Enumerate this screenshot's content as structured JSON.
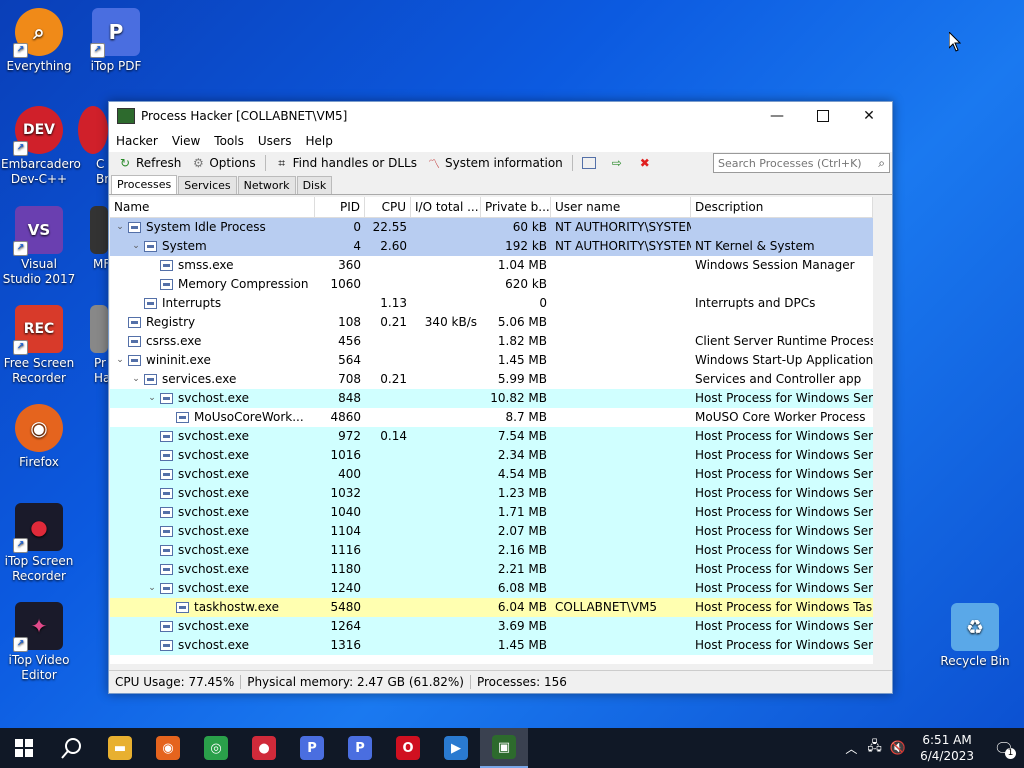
{
  "desktop": {
    "icons": [
      {
        "label": "Everything",
        "color": "#f08a18",
        "glyph": "⌕"
      },
      {
        "label": "iTop PDF",
        "color": "#4a6ee0",
        "glyph": "P"
      },
      {
        "label": "Embarcadero Dev-C++",
        "color": "#d0202a",
        "glyph": "DEV"
      },
      {
        "label": "Visual Studio 2017",
        "color": "#6a3fb0",
        "glyph": "VS"
      },
      {
        "label": "Free Screen Recorder",
        "color": "#d83a2a",
        "glyph": "REC"
      },
      {
        "label": "Firefox",
        "color": "#e5641e",
        "glyph": "◉"
      },
      {
        "label": "iTop Screen Recorder",
        "color": "#1a1a2a",
        "glyph": "●"
      },
      {
        "label": "iTop Video Editor",
        "color": "#1a1a2a",
        "glyph": "✦"
      },
      {
        "label": "Recycle Bin",
        "color": "#5aa8e8",
        "glyph": "♻"
      }
    ],
    "partial_labels": [
      "C",
      "Br",
      "MF",
      "Pr",
      "Ha"
    ]
  },
  "window": {
    "title": "Process Hacker [COLLABNET\\VM5]",
    "menu": [
      "Hacker",
      "View",
      "Tools",
      "Users",
      "Help"
    ],
    "toolbar": {
      "refresh": "Refresh",
      "options": "Options",
      "find_handles": "Find handles or DLLs",
      "system_info": "System information"
    },
    "search_placeholder": "Search Processes (Ctrl+K)",
    "tabs": [
      "Processes",
      "Services",
      "Network",
      "Disk"
    ],
    "columns": [
      "Name",
      "PID",
      "CPU",
      "I/O total ...",
      "Private b...",
      "User name",
      "Description"
    ],
    "rows": [
      {
        "name": "System Idle Process",
        "depth": 0,
        "exp": "v",
        "pid": "0",
        "cpu": "22.55",
        "io": "",
        "priv": "60 kB",
        "user": "NT AUTHORITY\\SYSTEM",
        "desc": "",
        "kind": "system"
      },
      {
        "name": "System",
        "depth": 1,
        "exp": "v",
        "pid": "4",
        "cpu": "2.60",
        "io": "",
        "priv": "192 kB",
        "user": "NT AUTHORITY\\SYSTEM",
        "desc": "NT Kernel & System",
        "kind": "system"
      },
      {
        "name": "smss.exe",
        "depth": 2,
        "exp": "",
        "pid": "360",
        "cpu": "",
        "io": "",
        "priv": "1.04 MB",
        "user": "",
        "desc": "Windows Session Manager",
        "kind": ""
      },
      {
        "name": "Memory Compression",
        "depth": 2,
        "exp": "",
        "pid": "1060",
        "cpu": "",
        "io": "",
        "priv": "620 kB",
        "user": "",
        "desc": "",
        "kind": ""
      },
      {
        "name": "Interrupts",
        "depth": 1,
        "exp": "",
        "pid": "",
        "cpu": "1.13",
        "io": "",
        "priv": "0",
        "user": "",
        "desc": "Interrupts and DPCs",
        "kind": ""
      },
      {
        "name": "Registry",
        "depth": 0,
        "exp": "",
        "pid": "108",
        "cpu": "0.21",
        "io": "340 kB/s",
        "priv": "5.06 MB",
        "user": "",
        "desc": "",
        "kind": ""
      },
      {
        "name": "csrss.exe",
        "depth": 0,
        "exp": "",
        "pid": "456",
        "cpu": "",
        "io": "",
        "priv": "1.82 MB",
        "user": "",
        "desc": "Client Server Runtime Process",
        "kind": ""
      },
      {
        "name": "wininit.exe",
        "depth": 0,
        "exp": "v",
        "pid": "564",
        "cpu": "",
        "io": "",
        "priv": "1.45 MB",
        "user": "",
        "desc": "Windows Start-Up Application",
        "kind": ""
      },
      {
        "name": "services.exe",
        "depth": 1,
        "exp": "v",
        "pid": "708",
        "cpu": "0.21",
        "io": "",
        "priv": "5.99 MB",
        "user": "",
        "desc": "Services and Controller app",
        "kind": ""
      },
      {
        "name": "svchost.exe",
        "depth": 2,
        "exp": "v",
        "pid": "848",
        "cpu": "",
        "io": "",
        "priv": "10.82 MB",
        "user": "",
        "desc": "Host Process for Windows Ser...",
        "kind": "service"
      },
      {
        "name": "MoUsoCoreWork...",
        "depth": 3,
        "exp": "",
        "pid": "4860",
        "cpu": "",
        "io": "",
        "priv": "8.7 MB",
        "user": "",
        "desc": "MoUSO Core Worker Process",
        "kind": ""
      },
      {
        "name": "svchost.exe",
        "depth": 2,
        "exp": "",
        "pid": "972",
        "cpu": "0.14",
        "io": "",
        "priv": "7.54 MB",
        "user": "",
        "desc": "Host Process for Windows Ser...",
        "kind": "service"
      },
      {
        "name": "svchost.exe",
        "depth": 2,
        "exp": "",
        "pid": "1016",
        "cpu": "",
        "io": "",
        "priv": "2.34 MB",
        "user": "",
        "desc": "Host Process for Windows Ser...",
        "kind": "service"
      },
      {
        "name": "svchost.exe",
        "depth": 2,
        "exp": "",
        "pid": "400",
        "cpu": "",
        "io": "",
        "priv": "4.54 MB",
        "user": "",
        "desc": "Host Process for Windows Ser...",
        "kind": "service"
      },
      {
        "name": "svchost.exe",
        "depth": 2,
        "exp": "",
        "pid": "1032",
        "cpu": "",
        "io": "",
        "priv": "1.23 MB",
        "user": "",
        "desc": "Host Process for Windows Ser...",
        "kind": "service"
      },
      {
        "name": "svchost.exe",
        "depth": 2,
        "exp": "",
        "pid": "1040",
        "cpu": "",
        "io": "",
        "priv": "1.71 MB",
        "user": "",
        "desc": "Host Process for Windows Ser...",
        "kind": "service"
      },
      {
        "name": "svchost.exe",
        "depth": 2,
        "exp": "",
        "pid": "1104",
        "cpu": "",
        "io": "",
        "priv": "2.07 MB",
        "user": "",
        "desc": "Host Process for Windows Ser...",
        "kind": "service"
      },
      {
        "name": "svchost.exe",
        "depth": 2,
        "exp": "",
        "pid": "1116",
        "cpu": "",
        "io": "",
        "priv": "2.16 MB",
        "user": "",
        "desc": "Host Process for Windows Ser...",
        "kind": "service"
      },
      {
        "name": "svchost.exe",
        "depth": 2,
        "exp": "",
        "pid": "1180",
        "cpu": "",
        "io": "",
        "priv": "2.21 MB",
        "user": "",
        "desc": "Host Process for Windows Ser...",
        "kind": "service"
      },
      {
        "name": "svchost.exe",
        "depth": 2,
        "exp": "v",
        "pid": "1240",
        "cpu": "",
        "io": "",
        "priv": "6.08 MB",
        "user": "",
        "desc": "Host Process for Windows Ser...",
        "kind": "service"
      },
      {
        "name": "taskhostw.exe",
        "depth": 3,
        "exp": "",
        "pid": "5480",
        "cpu": "",
        "io": "",
        "priv": "6.04 MB",
        "user": "COLLABNET\\VM5",
        "desc": "Host Process for Windows Tasks",
        "kind": "own"
      },
      {
        "name": "svchost.exe",
        "depth": 2,
        "exp": "",
        "pid": "1264",
        "cpu": "",
        "io": "",
        "priv": "3.69 MB",
        "user": "",
        "desc": "Host Process for Windows Ser...",
        "kind": "service"
      },
      {
        "name": "svchost.exe",
        "depth": 2,
        "exp": "",
        "pid": "1316",
        "cpu": "",
        "io": "",
        "priv": "1.45 MB",
        "user": "",
        "desc": "Host Process for Windows Ser...",
        "kind": "service"
      }
    ],
    "status": {
      "cpu": "CPU Usage: 77.45%",
      "memory": "Physical memory: 2.47 GB (61.82%)",
      "processes": "Processes: 156"
    }
  },
  "taskbar": {
    "items": [
      {
        "name": "file-explorer",
        "color": "#e8b030",
        "glyph": "▬"
      },
      {
        "name": "firefox",
        "color": "#e5641e",
        "glyph": "◉"
      },
      {
        "name": "chrome",
        "color": "#2aa04a",
        "glyph": "◎"
      },
      {
        "name": "itop-screen-recorder",
        "color": "#d02a3a",
        "glyph": "●"
      },
      {
        "name": "itop-pdf",
        "color": "#4a6ee0",
        "glyph": "P"
      },
      {
        "name": "itop-pdf-2",
        "color": "#4a6ee0",
        "glyph": "P"
      },
      {
        "name": "opera",
        "color": "#d01020",
        "glyph": "O"
      },
      {
        "name": "video-editor",
        "color": "#2a7ad0",
        "glyph": "▶"
      },
      {
        "name": "process-hacker",
        "color": "#2d6a2d",
        "glyph": "▣"
      }
    ],
    "time": "6:51 AM",
    "date": "6/4/2023",
    "notification_count": "1"
  }
}
